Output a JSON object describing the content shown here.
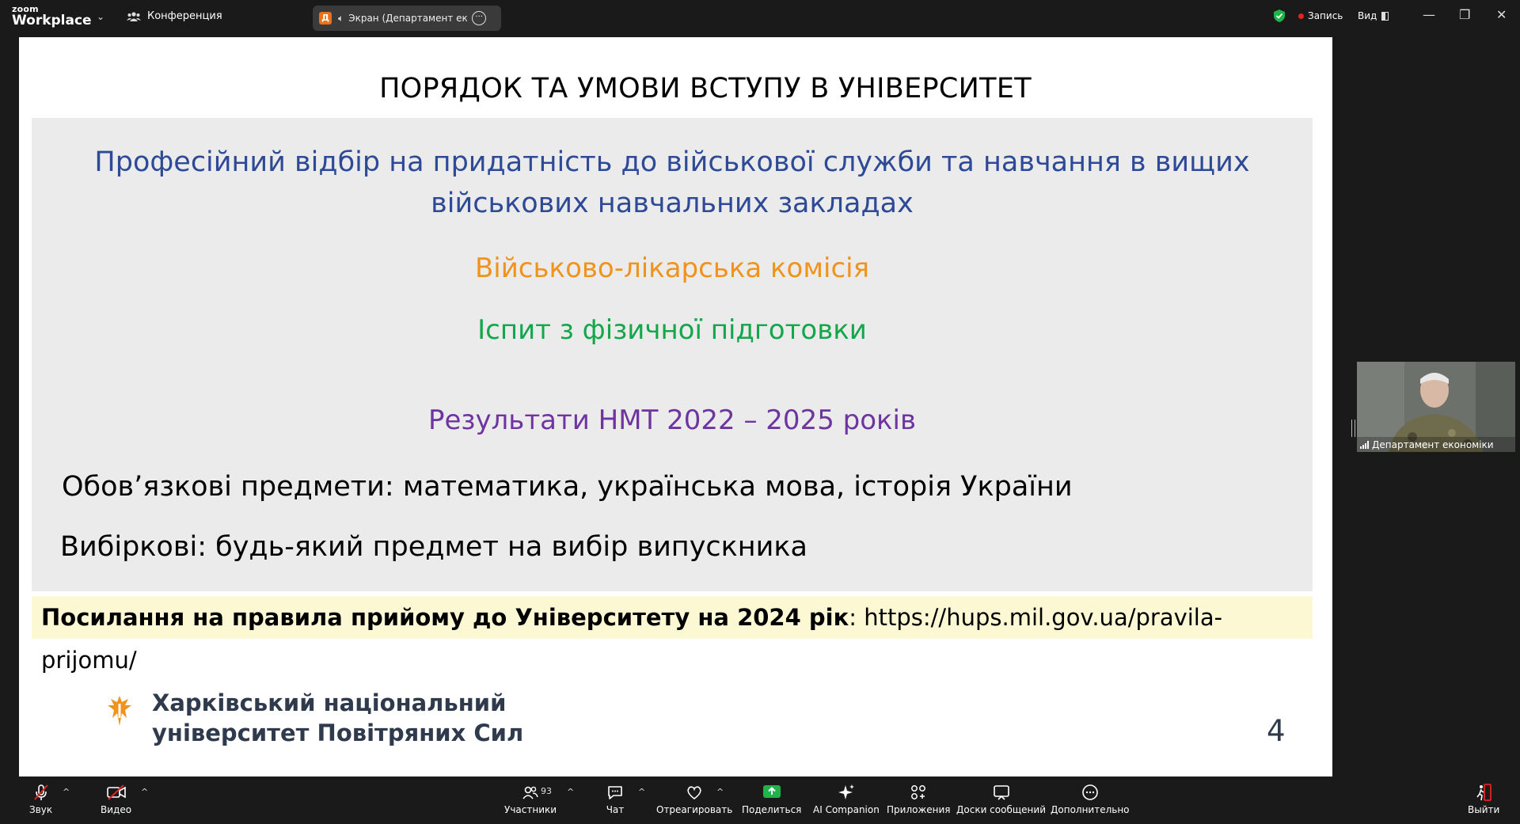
{
  "app": {
    "logo_small": "zoom",
    "logo_big": "Workplace",
    "conference_label": "Конференция",
    "screen_badge": "Д",
    "screen_share_label": "Экран (Департамент економіки)",
    "record_label": "Запись",
    "view_label": "Вид"
  },
  "slide": {
    "title": "ПОРЯДОК ТА УМОВИ ВСТУПУ В УНІВЕРСИТЕТ",
    "line1a": "Професійний відбір на придатність до військової служби та навчання в вищих",
    "line1b": "військових навчальних закладах",
    "line2": "Військово-лікарська комісія",
    "line3": "Іспит з фізичної підготовки",
    "line4": "Результати НМТ 2022 – 2025 років",
    "line5": "Обов’язкові предмети: математика, українська мова, історія України",
    "line6": "Вибіркові: будь-який предмет на вибір випускника",
    "link_bold": "Посилання на правила прийому до Університету на 2024 рік",
    "link_rest": ": https://hups.mil.gov.ua/pravila-prijomu/",
    "uni_line1": "Харківський національний",
    "uni_line2": "університет Повітряних Сил",
    "page_number": "4",
    "colors": {
      "blue": "#2e4a97",
      "orange": "#f0931c",
      "green": "#13a64a",
      "purple": "#6e34a0",
      "link_bg": "#fcf8d4",
      "box_bg": "#ebebeb"
    }
  },
  "video": {
    "participant_name": "Департамент економіки"
  },
  "toolbar": {
    "audio_label": "Звук",
    "video_label": "Видео",
    "participants_label": "Участники",
    "participants_count": "93",
    "chat_label": "Чат",
    "react_label": "Отреагировать",
    "share_label": "Поделиться",
    "ai_label": "AI Companion",
    "apps_label": "Приложения",
    "boards_label": "Доски сообщений",
    "more_label": "Дополнительно",
    "leave_label": "Выйти"
  }
}
